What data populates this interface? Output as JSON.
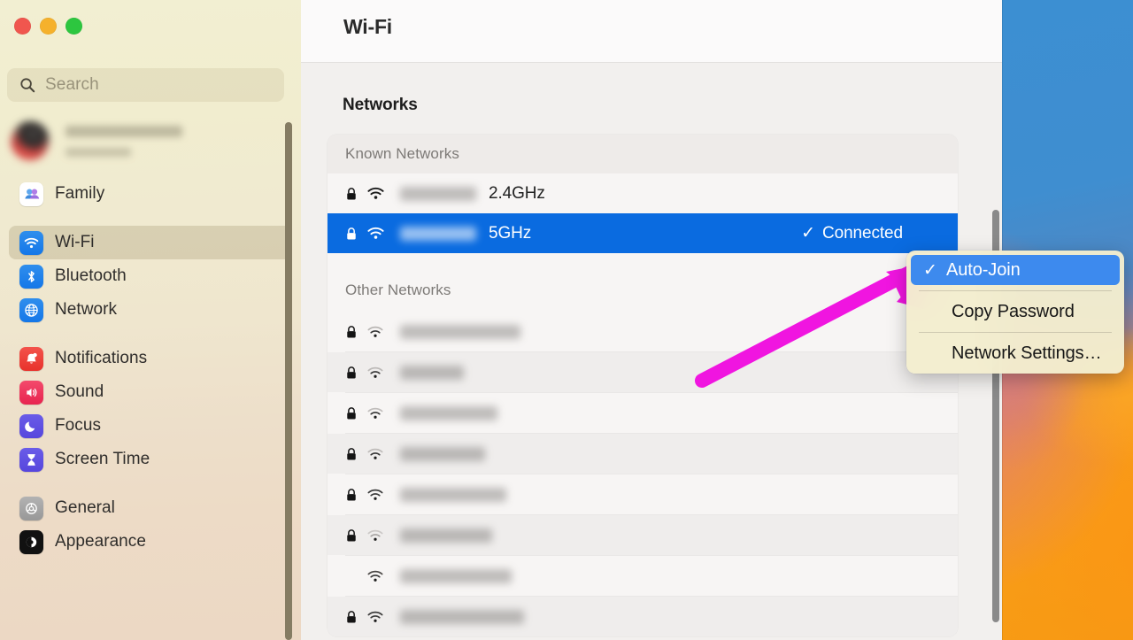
{
  "window": {
    "traffic_lights": [
      {
        "name": "close",
        "color": "#f0564e"
      },
      {
        "name": "minimize",
        "color": "#f5b12c"
      },
      {
        "name": "zoom",
        "color": "#2dc63f"
      }
    ],
    "title": "Wi-Fi"
  },
  "sidebar": {
    "search": {
      "placeholder": "Search",
      "value": "",
      "icon": "search-icon"
    },
    "account": {
      "name_redacted": true,
      "subtitle_redacted": true
    },
    "items": [
      {
        "label": "Family",
        "icon": "family-icon",
        "selected": false,
        "group": 0
      },
      {
        "label": "Wi-Fi",
        "icon": "wifi-icon",
        "selected": true,
        "group": 1
      },
      {
        "label": "Bluetooth",
        "icon": "bluetooth-icon",
        "selected": false,
        "group": 1
      },
      {
        "label": "Network",
        "icon": "network-globe-icon",
        "selected": false,
        "group": 1
      },
      {
        "label": "Notifications",
        "icon": "notifications-icon",
        "selected": false,
        "group": 2
      },
      {
        "label": "Sound",
        "icon": "sound-icon",
        "selected": false,
        "group": 2
      },
      {
        "label": "Focus",
        "icon": "focus-moon-icon",
        "selected": false,
        "group": 2
      },
      {
        "label": "Screen Time",
        "icon": "screen-time-icon",
        "selected": false,
        "group": 2
      },
      {
        "label": "General",
        "icon": "general-gear-icon",
        "selected": false,
        "group": 3
      },
      {
        "label": "Appearance",
        "icon": "appearance-icon",
        "selected": false,
        "group": 3
      }
    ]
  },
  "main": {
    "section_title": "Networks",
    "groups": [
      {
        "header": "Known Networks",
        "rows": [
          {
            "locked": true,
            "signal": "strong",
            "ssid_redacted": true,
            "ssid_width": 86,
            "band": "2.4GHz",
            "status": "",
            "selected": false
          },
          {
            "locked": true,
            "signal": "strong",
            "ssid_redacted": true,
            "ssid_width": 86,
            "band": "5GHz",
            "status": "Connected",
            "status_check": "✓",
            "selected": true
          }
        ]
      },
      {
        "header": "Other Networks",
        "rows": [
          {
            "locked": true,
            "signal": "medium",
            "ssid_redacted": true,
            "ssid_width": 136,
            "band": "",
            "status": "",
            "selected": false
          },
          {
            "locked": true,
            "signal": "medium",
            "ssid_redacted": true,
            "ssid_width": 72,
            "band": "",
            "status": "",
            "selected": false
          },
          {
            "locked": true,
            "signal": "medium",
            "ssid_redacted": true,
            "ssid_width": 110,
            "band": "",
            "status": "",
            "selected": false
          },
          {
            "locked": true,
            "signal": "medium",
            "ssid_redacted": true,
            "ssid_width": 96,
            "band": "",
            "status": "",
            "selected": false
          },
          {
            "locked": true,
            "signal": "strong",
            "ssid_redacted": true,
            "ssid_width": 120,
            "band": "",
            "status": "",
            "selected": false
          },
          {
            "locked": true,
            "signal": "weak",
            "ssid_redacted": true,
            "ssid_width": 104,
            "band": "",
            "status": "",
            "selected": false
          },
          {
            "locked": false,
            "signal": "medium",
            "ssid_redacted": true,
            "ssid_width": 126,
            "band": "",
            "status": "",
            "selected": false
          },
          {
            "locked": true,
            "signal": "strong",
            "ssid_redacted": true,
            "ssid_width": 140,
            "band": "",
            "status": "",
            "selected": false
          }
        ]
      }
    ]
  },
  "context_menu": {
    "items": [
      {
        "label": "Auto-Join",
        "checked": true,
        "check_glyph": "✓",
        "highlighted": true
      },
      {
        "label": "Copy Password",
        "checked": false,
        "highlighted": false
      },
      {
        "label": "Network Settings…",
        "checked": false,
        "highlighted": false
      }
    ]
  },
  "annotation": {
    "arrow_color": "#f015e0",
    "points_to": "Auto-Join"
  },
  "colors": {
    "selection_blue": "#0a6be0",
    "menu_highlight_blue": "#3d8aee",
    "sidebar_top": "#f2efd2",
    "sidebar_bottom": "#ecd8c4",
    "content_bg": "#f2f0ee",
    "card_bg": "#f7f5f4",
    "arrow_magenta": "#f015e0"
  }
}
